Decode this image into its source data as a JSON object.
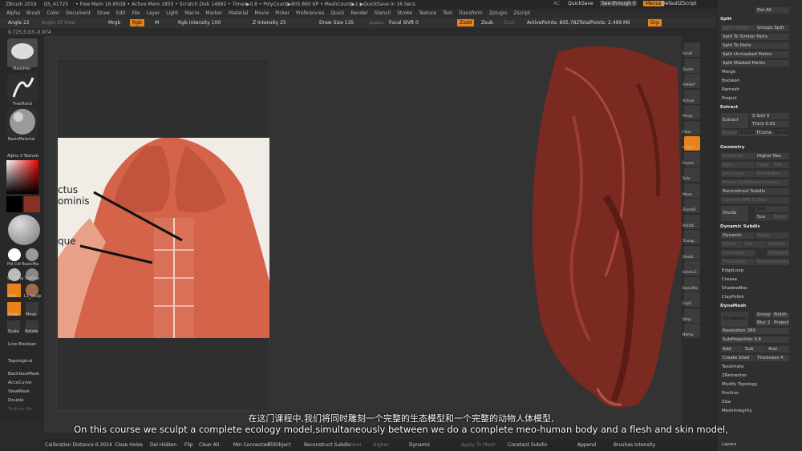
{
  "titlebar": {
    "items": [
      "ZBrush 2019",
      "QS_41725",
      "• Free Mem 16.85GB • Active Mem 1855 • Scratch Disk 14892 • Timer▶0.8 • PolyCount▶805.865 KP • MeshCount▶1 ▶QuickSave In 16 Secs"
    ],
    "ac": "AC",
    "quicksave": "QuickSave",
    "seethrough": "See-through  0",
    "menus": "Menus",
    "script": "DefaultZScript"
  },
  "menubar": [
    "Alpha",
    "Brush",
    "Color",
    "Document",
    "Draw",
    "Edit",
    "File",
    "Layer",
    "Light",
    "Macro",
    "Marker",
    "Material",
    "Movie",
    "Picker",
    "Preferences",
    "Quick",
    "Render",
    "Stencil",
    "Stroke",
    "Texture",
    "Tool",
    "Transform",
    "Zplugin",
    "Zscript"
  ],
  "toolbar": {
    "angle": "Angle 22",
    "angle_of_view": "Angle Of View",
    "mrgb": "Mrgb",
    "rgb": "Rgb",
    "m": "M",
    "rgb_intensity": "Rgb Intensity 100",
    "z_intensity": "Z Intensity 25",
    "draw_size": "Draw Size 135",
    "dynamic": "Dynamic",
    "focal_shift": "Focal Shift 0",
    "zadd": "Zadd",
    "zsub": "Zsub",
    "zcut": "Zcut",
    "active_points": "ActivePoints: 805,782",
    "total_points": "TotalPoints: 2.499 Mil",
    "grp": "Grp"
  },
  "coords": "0.725,5.03,-0.974",
  "left_shelf": {
    "maskpen": "MaskPen",
    "freehand": "FreeHand",
    "basicmaterial": "BasicMaterial",
    "alpha": "Alpha 3 Texture",
    "pol": "Pol Col BasicMa",
    "skin": "SkinSha ToyPlas",
    "edit": "Edit",
    "scale": "Scale",
    "rotate": "Rotate",
    "draw": "Draw",
    "move": "Move",
    "live_boolean": "Live Boolean",
    "topological": "Topological",
    "backface": "BackfaceMask",
    "accucurve": "AccuCurve",
    "viewmask": "ViewMask",
    "double": "Double",
    "texture_on": "Texture On",
    "l1": "L1_sculp"
  },
  "reference": {
    "text1": "ctus",
    "text2": "ominis",
    "text3": "que"
  },
  "right_shelf": [
    "Scroll",
    "Zoom",
    "AAHalf",
    "Actual",
    "Persp",
    "Floor",
    "L.Sym",
    "Frame",
    "Solo",
    "Move",
    "ZoomD",
    "RotatE",
    "Transp",
    "Ghost",
    "Green E",
    "BasicMa",
    "Exp5",
    "Dmp",
    "Ndmp"
  ],
  "panel": {
    "del_all": "Del All",
    "split": "Split",
    "split_hidden": "Split Hidden",
    "groups_split": "Groups Split",
    "split_similar": "Split To Similar Parts",
    "split_parts": "Split To Parts",
    "split_unmasked": "Split Unmasked Points",
    "split_masked": "Split Masked Points",
    "merge": "Merge",
    "boolean": "Boolean",
    "remesh": "Remesh",
    "project": "Project",
    "extract": "Extract",
    "extract_btn": "Extract",
    "smt": "S Smt 5",
    "thick": "Thick 0.02",
    "accept": "Accept",
    "double": "Double",
    "tcorn": "TCorne",
    "tborde": "TBorde",
    "geometry": "Geometry",
    "lower_res": "Lower Res",
    "higher_res": "Higher Res",
    "sdiv": "SDiv",
    "cage": "Cage",
    "rstr": "Rstr",
    "del_lower": "Del Lower",
    "del_higher": "Del Higher",
    "freeze": "Freeze SubDivision Levels",
    "reconstruct": "Reconstruct Subdiv",
    "convert": "Convert BPR To Geo",
    "divide": "Divide",
    "smt2": "Smt",
    "suv": "Suv",
    "reuv": "ReUV",
    "dynamic_subdiv": "Dynamic Subdiv",
    "dynamic": "Dynamic",
    "apply": "Apply",
    "qgrid": "QGrid",
    "flat": "Flat",
    "smooth": "Smooth",
    "coverage": "Coverage",
    "constant": "Constant",
    "flat_subdiv": "FlatSubdiv",
    "smooth_subdiv": "SmoothSubdiv",
    "edgeloop": "EdgeLoop",
    "crease": "Crease",
    "shadowbox": "ShadowBox",
    "claypolish": "ClayPolish",
    "dynamesh": "DynaMesh",
    "dynamesh_btn": "DynaMesh",
    "group": "Group",
    "polish": "Polish",
    "blur": "Blur 2",
    "project2": "Project",
    "resolution": "Resolution 360",
    "subprojection": "SubProjection 0.6",
    "add": "Add",
    "sub": "Sub",
    "and": "And",
    "create_shell": "Create Shell",
    "thickness": "Thickness 4",
    "tessimate": "Tessimate",
    "zremesher": "ZRemesher",
    "modify_topology": "Modify Topology",
    "position": "Position",
    "size": "Size",
    "meshintegrity": "MeshIntegrity",
    "layers": "Layers"
  },
  "bottombar": {
    "calibration": "Calibration Distance 0.3024",
    "close_holes": "Close Holes",
    "del_hidden": "Del Hidden",
    "flip": "Flip",
    "clear_all": "Clear All",
    "min_connected": "Min Connected",
    "fill_object": "FillObject",
    "reconstruct": "Reconstruct Subdiv",
    "lower": "Lower",
    "higher": "Higher",
    "dynamic": "Dynamic",
    "apply_to_mesh": "Apply To Mesh",
    "constant_subdiv": "Constant Subdiv",
    "append": "Append",
    "brushes_intensity": "Brushes Intensity"
  },
  "subtitles": {
    "zh": "在这门课程中,我们将同时雕刻一个完整的生态模型和一个完整的动物人体模型,",
    "en": "On this course we sculpt a complete ecology model,simultaneously between we do a complete meo-human body and a flesh and skin model,"
  },
  "colors": {
    "accent": "#e8821a",
    "muscle": "#8a2f22",
    "background": "#2a2a2a"
  }
}
